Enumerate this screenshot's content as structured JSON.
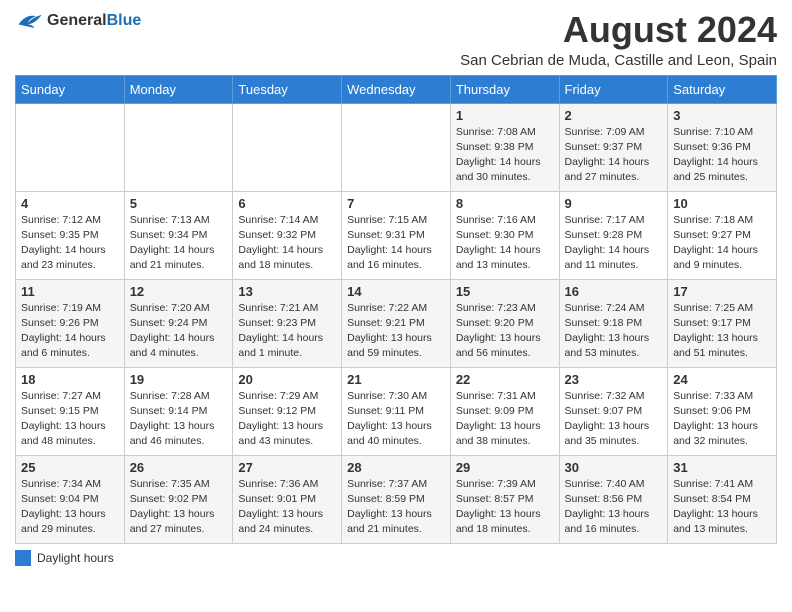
{
  "header": {
    "logo_general": "General",
    "logo_blue": "Blue",
    "title": "August 2024",
    "location": "San Cebrian de Muda, Castille and Leon, Spain"
  },
  "days_of_week": [
    "Sunday",
    "Monday",
    "Tuesday",
    "Wednesday",
    "Thursday",
    "Friday",
    "Saturday"
  ],
  "weeks": [
    [
      {
        "day": "",
        "info": ""
      },
      {
        "day": "",
        "info": ""
      },
      {
        "day": "",
        "info": ""
      },
      {
        "day": "",
        "info": ""
      },
      {
        "day": "1",
        "info": "Sunrise: 7:08 AM\nSunset: 9:38 PM\nDaylight: 14 hours\nand 30 minutes."
      },
      {
        "day": "2",
        "info": "Sunrise: 7:09 AM\nSunset: 9:37 PM\nDaylight: 14 hours\nand 27 minutes."
      },
      {
        "day": "3",
        "info": "Sunrise: 7:10 AM\nSunset: 9:36 PM\nDaylight: 14 hours\nand 25 minutes."
      }
    ],
    [
      {
        "day": "4",
        "info": "Sunrise: 7:12 AM\nSunset: 9:35 PM\nDaylight: 14 hours\nand 23 minutes."
      },
      {
        "day": "5",
        "info": "Sunrise: 7:13 AM\nSunset: 9:34 PM\nDaylight: 14 hours\nand 21 minutes."
      },
      {
        "day": "6",
        "info": "Sunrise: 7:14 AM\nSunset: 9:32 PM\nDaylight: 14 hours\nand 18 minutes."
      },
      {
        "day": "7",
        "info": "Sunrise: 7:15 AM\nSunset: 9:31 PM\nDaylight: 14 hours\nand 16 minutes."
      },
      {
        "day": "8",
        "info": "Sunrise: 7:16 AM\nSunset: 9:30 PM\nDaylight: 14 hours\nand 13 minutes."
      },
      {
        "day": "9",
        "info": "Sunrise: 7:17 AM\nSunset: 9:28 PM\nDaylight: 14 hours\nand 11 minutes."
      },
      {
        "day": "10",
        "info": "Sunrise: 7:18 AM\nSunset: 9:27 PM\nDaylight: 14 hours\nand 9 minutes."
      }
    ],
    [
      {
        "day": "11",
        "info": "Sunrise: 7:19 AM\nSunset: 9:26 PM\nDaylight: 14 hours\nand 6 minutes."
      },
      {
        "day": "12",
        "info": "Sunrise: 7:20 AM\nSunset: 9:24 PM\nDaylight: 14 hours\nand 4 minutes."
      },
      {
        "day": "13",
        "info": "Sunrise: 7:21 AM\nSunset: 9:23 PM\nDaylight: 14 hours\nand 1 minute."
      },
      {
        "day": "14",
        "info": "Sunrise: 7:22 AM\nSunset: 9:21 PM\nDaylight: 13 hours\nand 59 minutes."
      },
      {
        "day": "15",
        "info": "Sunrise: 7:23 AM\nSunset: 9:20 PM\nDaylight: 13 hours\nand 56 minutes."
      },
      {
        "day": "16",
        "info": "Sunrise: 7:24 AM\nSunset: 9:18 PM\nDaylight: 13 hours\nand 53 minutes."
      },
      {
        "day": "17",
        "info": "Sunrise: 7:25 AM\nSunset: 9:17 PM\nDaylight: 13 hours\nand 51 minutes."
      }
    ],
    [
      {
        "day": "18",
        "info": "Sunrise: 7:27 AM\nSunset: 9:15 PM\nDaylight: 13 hours\nand 48 minutes."
      },
      {
        "day": "19",
        "info": "Sunrise: 7:28 AM\nSunset: 9:14 PM\nDaylight: 13 hours\nand 46 minutes."
      },
      {
        "day": "20",
        "info": "Sunrise: 7:29 AM\nSunset: 9:12 PM\nDaylight: 13 hours\nand 43 minutes."
      },
      {
        "day": "21",
        "info": "Sunrise: 7:30 AM\nSunset: 9:11 PM\nDaylight: 13 hours\nand 40 minutes."
      },
      {
        "day": "22",
        "info": "Sunrise: 7:31 AM\nSunset: 9:09 PM\nDaylight: 13 hours\nand 38 minutes."
      },
      {
        "day": "23",
        "info": "Sunrise: 7:32 AM\nSunset: 9:07 PM\nDaylight: 13 hours\nand 35 minutes."
      },
      {
        "day": "24",
        "info": "Sunrise: 7:33 AM\nSunset: 9:06 PM\nDaylight: 13 hours\nand 32 minutes."
      }
    ],
    [
      {
        "day": "25",
        "info": "Sunrise: 7:34 AM\nSunset: 9:04 PM\nDaylight: 13 hours\nand 29 minutes."
      },
      {
        "day": "26",
        "info": "Sunrise: 7:35 AM\nSunset: 9:02 PM\nDaylight: 13 hours\nand 27 minutes."
      },
      {
        "day": "27",
        "info": "Sunrise: 7:36 AM\nSunset: 9:01 PM\nDaylight: 13 hours\nand 24 minutes."
      },
      {
        "day": "28",
        "info": "Sunrise: 7:37 AM\nSunset: 8:59 PM\nDaylight: 13 hours\nand 21 minutes."
      },
      {
        "day": "29",
        "info": "Sunrise: 7:39 AM\nSunset: 8:57 PM\nDaylight: 13 hours\nand 18 minutes."
      },
      {
        "day": "30",
        "info": "Sunrise: 7:40 AM\nSunset: 8:56 PM\nDaylight: 13 hours\nand 16 minutes."
      },
      {
        "day": "31",
        "info": "Sunrise: 7:41 AM\nSunset: 8:54 PM\nDaylight: 13 hours\nand 13 minutes."
      }
    ]
  ],
  "legend": {
    "color_label": "Daylight hours"
  }
}
